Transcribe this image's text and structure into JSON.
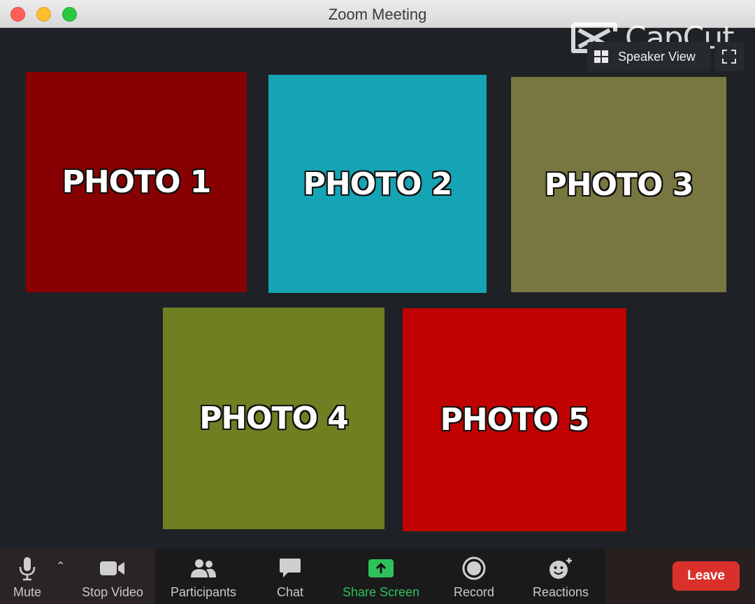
{
  "window": {
    "title": "Zoom Meeting"
  },
  "watermark": {
    "text": "CapCut"
  },
  "view_controls": {
    "speaker_view_label": "Speaker View"
  },
  "tiles": [
    {
      "label": "PHOTO 1",
      "color": "#880102"
    },
    {
      "label": "PHOTO 2",
      "color": "#15a4b4"
    },
    {
      "label": "PHOTO 3",
      "color": "#797741"
    },
    {
      "label": "PHOTO 4",
      "color": "#6f7f22"
    },
    {
      "label": "PHOTO 5",
      "color": "#c00302"
    }
  ],
  "toolbar": {
    "mute_label": "Mute",
    "stop_video_label": "Stop Video",
    "participants_label": "Participants",
    "chat_label": "Chat",
    "share_screen_label": "Share Screen",
    "record_label": "Record",
    "reactions_label": "Reactions",
    "leave_label": "Leave"
  },
  "colors": {
    "share_accent": "#2fc15a",
    "leave": "#d9302b"
  }
}
